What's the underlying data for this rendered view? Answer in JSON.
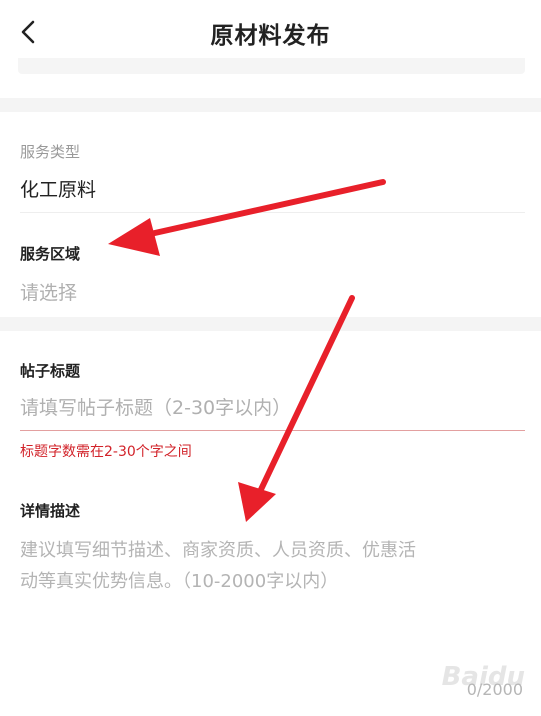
{
  "header": {
    "title": "原材料发布",
    "back_icon": "chevron-left-icon"
  },
  "form": {
    "service_type": {
      "label": "服务类型",
      "value": "化工原料"
    },
    "service_area": {
      "label": "服务区域",
      "placeholder": "请选择"
    },
    "post_title": {
      "label": "帖子标题",
      "placeholder": "请填写帖子标题（2-30字以内）",
      "error": "标题字数需在2-30个字之间"
    },
    "details": {
      "label": "详情描述",
      "placeholder_line1": "建议填写细节描述、商家资质、人员资质、优惠活",
      "placeholder_line2": "动等真实优势信息。（10-2000字以内）",
      "counter": "0/2000"
    }
  },
  "annotations": {
    "arrow_color": "#e8202a"
  },
  "watermark": "Baidu"
}
